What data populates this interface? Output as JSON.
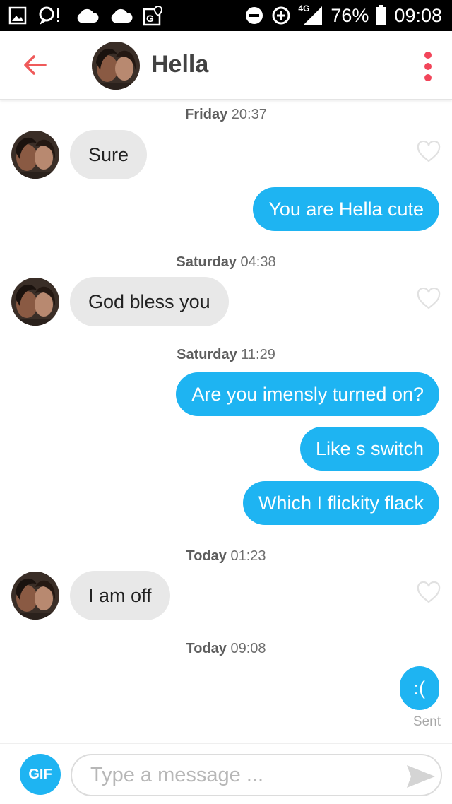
{
  "status_bar": {
    "battery_percent": "76%",
    "time": "09:08",
    "network": "4G",
    "icons": [
      "image-icon",
      "location-alert-icon",
      "cloud-icon",
      "cloud-icon",
      "maps-icon",
      "dnd-icon",
      "data-saver-icon",
      "signal-icon",
      "battery-icon"
    ]
  },
  "header": {
    "contact_name": "Hella"
  },
  "messages": [
    {
      "type": "timestamp",
      "day": "Friday",
      "time": "20:37"
    },
    {
      "type": "incoming",
      "text": "Sure"
    },
    {
      "type": "outgoing",
      "text": "You are Hella cute"
    },
    {
      "type": "timestamp",
      "day": "Saturday",
      "time": "04:38"
    },
    {
      "type": "incoming",
      "text": "God bless you"
    },
    {
      "type": "timestamp",
      "day": "Saturday",
      "time": "11:29"
    },
    {
      "type": "outgoing",
      "text": "Are you imensly turned on?"
    },
    {
      "type": "outgoing",
      "text": "Like s switch"
    },
    {
      "type": "outgoing",
      "text": "Which I flickity flack"
    },
    {
      "type": "timestamp",
      "day": "Today",
      "time": "01:23"
    },
    {
      "type": "incoming",
      "text": "I am off"
    },
    {
      "type": "timestamp",
      "day": "Today",
      "time": "09:08"
    },
    {
      "type": "outgoing",
      "text": ":("
    }
  ],
  "delivery_status": "Sent",
  "composer": {
    "gif_label": "GIF",
    "placeholder": "Type a message ..."
  },
  "colors": {
    "accent": "#1eb4f2",
    "back_arrow": "#ef5a5a",
    "menu_dots": "#f2455a",
    "incoming_bubble": "#e8e8e8"
  }
}
